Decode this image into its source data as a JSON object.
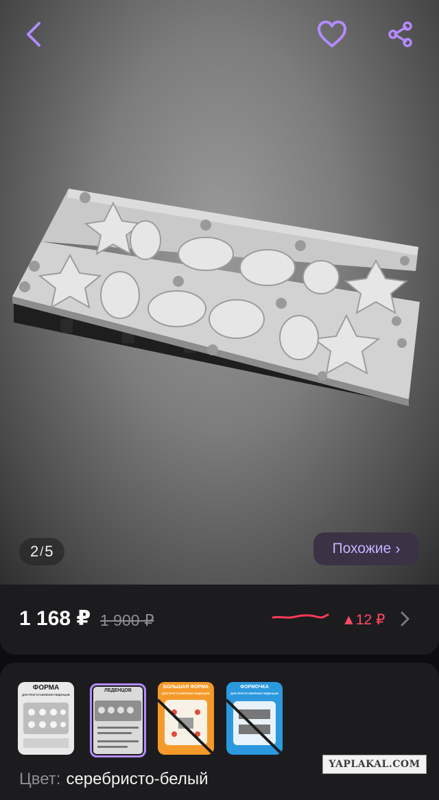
{
  "gallery": {
    "current": "2",
    "separator": "/",
    "total": "5",
    "similar_label": "Похожие",
    "similar_chevron": "›"
  },
  "price": {
    "current": "1 168 ₽",
    "old": "1 900 ₽",
    "change": "▲12 ₽"
  },
  "variants": [
    {
      "title": "ФОРМА",
      "subtitle": "ДЛЯ ПРИГОТОВЛЕНИЯ ЛЕДЕНЦОВ",
      "selected": false
    },
    {
      "title": "ЛЕДЕНЦОВ",
      "subtitle": "",
      "selected": true
    },
    {
      "title": "БОЛЬШАЯ ФОРМА",
      "subtitle": "ДЛЯ ПРИГОТОВЛЕНИЯ ЛЕДЕНЦОВ",
      "selected": false
    },
    {
      "title": "ФОРМОЧКА",
      "subtitle": "ДЛЯ ПРИГОТОВЛЕНИЯ ЛЕДЕНЦОВ",
      "selected": false
    }
  ],
  "color": {
    "label": "Цвет:",
    "value": "серебристо-белый"
  },
  "watermark": "YAPLAKAL.COM",
  "colors": {
    "accent": "#b48bff",
    "similar_text": "#c9b1ff",
    "price_up": "#ff4a62",
    "card_bg": "#1c1c1f"
  },
  "icons": [
    "back-arrow-icon",
    "heart-icon",
    "share-icon",
    "chevron-right-icon"
  ]
}
